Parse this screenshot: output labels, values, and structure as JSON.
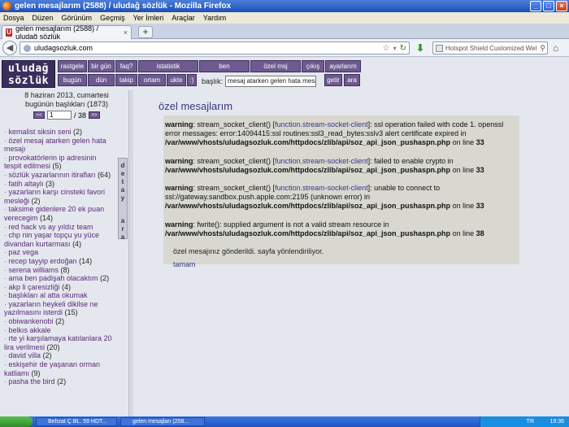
{
  "window": {
    "title": "gelen mesajlarım (2588) / uludağ sözlük - Mozilla Firefox"
  },
  "menubar": [
    "Dosya",
    "Düzen",
    "Görünüm",
    "Geçmiş",
    "Yer İmleri",
    "Araçlar",
    "Yardım"
  ],
  "tab": {
    "title": "gelen mesajlarım (2588) / uludağ sözlük",
    "favicon": "U"
  },
  "urlbar": {
    "value": "uludagsozluk.com"
  },
  "searchbar": {
    "placeholder": "Hotspot Shield Customized Wel"
  },
  "site": {
    "logo": "uludağ sözlük",
    "nav_row1": [
      "rastgele",
      "bir gün",
      "faq?",
      "istatistik",
      "ben",
      "özel msj",
      "çıkış",
      "ayarlarım"
    ],
    "nav_row2": [
      "bugün",
      "dün",
      "takip",
      "ortam",
      "ukte",
      ":)"
    ],
    "baslik_label": "başlık:",
    "baslik_value": "mesaj atarken gelen hata mesajı",
    "getir": "getir",
    "ara": "ara"
  },
  "sidebar": {
    "date": "8 haziran 2013, cumartesi",
    "today_count": "bugünün başlıkları (1873)",
    "page_current": "1",
    "page_total": "/ 38",
    "prev": "<<",
    "next": ">>",
    "vtab_top": "d e t a y",
    "vtab_bottom": "a r a",
    "topics": [
      {
        "title": "kemalist siksin seni",
        "count": "(2)"
      },
      {
        "title": "özel mesaj atarken gelen hata mesajı",
        "count": ""
      },
      {
        "title": "provokatörlerin ip adresinin tespit edilmesi",
        "count": "(5)"
      },
      {
        "title": "sözlük yazarlarının itirafları",
        "count": "(64)"
      },
      {
        "title": "fatih altaylı",
        "count": "(3)"
      },
      {
        "title": "yazarların karşı cinsteki favori mesleği",
        "count": "(2)"
      },
      {
        "title": "taksime gidenlere 20 ek puan verecegim",
        "count": "(14)"
      },
      {
        "title": "red hack vs ay yıldız team",
        "count": ""
      },
      {
        "title": "chp nin yaşar topçu yu yüce divandan kurtarması",
        "count": "(4)"
      },
      {
        "title": "paz vega",
        "count": ""
      },
      {
        "title": "recep tayyip erdoğan",
        "count": "(14)"
      },
      {
        "title": "serena williams",
        "count": "(8)"
      },
      {
        "title": "ama ben padişah olacaktım",
        "count": "(2)"
      },
      {
        "title": "akp li çaresizliği",
        "count": "(4)"
      },
      {
        "title": "başlıkları al atta okumak",
        "count": ""
      },
      {
        "title": "yazarların heykeli dikilse ne yazılmasını isterdi",
        "count": "(15)"
      },
      {
        "title": "obiwankenobi",
        "count": "(2)"
      },
      {
        "title": "belkıs akkale",
        "count": ""
      },
      {
        "title": "rte yi karşılamaya katılanlara 20 lira verilmesi",
        "count": "(20)"
      },
      {
        "title": "david villa",
        "count": "(2)"
      },
      {
        "title": "eskişehir de yaşanan orman katliamı",
        "count": "(9)"
      },
      {
        "title": "pasha the bird",
        "count": "(2)"
      }
    ]
  },
  "content": {
    "heading": "özel mesajlarım",
    "warnings": [
      {
        "label": "warning",
        "pre": ": stream_socket_client() [",
        "link": "function.stream-socket-client",
        "post": "]: ssl operation failed with code 1. openssl error messages: error:14094415:ssl routines:ssl3_read_bytes:sslv3 alert certificate expired in ",
        "path": "/var/www/vhosts/uludagsozluk.com/httpdocs/zlib/api/soz_api_json_pushaspn.php",
        "online": " on line ",
        "line": "33"
      },
      {
        "label": "warning",
        "pre": ": stream_socket_client() [",
        "link": "function.stream-socket-client",
        "post": "]: failed to enable crypto in ",
        "path": "/var/www/vhosts/uludagsozluk.com/httpdocs/zlib/api/soz_api_json_pushaspn.php",
        "online": " on line ",
        "line": "33"
      },
      {
        "label": "warning",
        "pre": ": stream_socket_client() [",
        "link": "function.stream-socket-client",
        "post": "]: unable to connect to ssl://gateway.sandbox.push.apple.com:2195 (unknown error) in ",
        "path": "/var/www/vhosts/uludagsozluk.com/httpdocs/zlib/api/soz_api_json_pushaspn.php",
        "online": " on line ",
        "line": "33"
      },
      {
        "label": "warning",
        "pre": ": fwrite(): supplied argument is not a valid stream resource in ",
        "link": "",
        "post": "",
        "path": "/var/www/vhosts/uludagsozluk.com/httpdocs/zlib/api/soz_api_json_pushaspn.php",
        "online": " on line ",
        "line": "38"
      }
    ],
    "sent_message": "özel mesajınız gönderildi. sayfa yönlendiriliyor.",
    "tamam": "tamam"
  },
  "taskbar": {
    "items": [
      "Behzat Ç BL. 59 HDT...",
      "gelen mesajları (258..."
    ],
    "lang": "TR",
    "clock": "19:36"
  }
}
